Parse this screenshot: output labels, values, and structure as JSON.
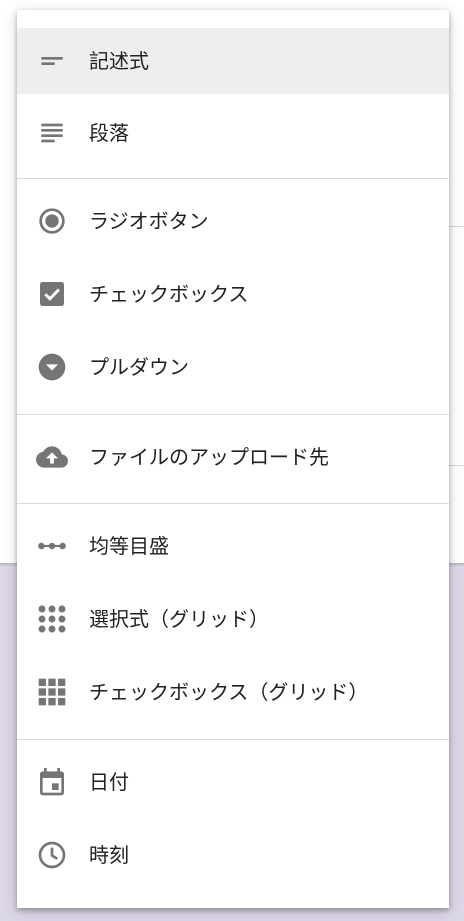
{
  "menu": {
    "items": [
      {
        "label": "記述式",
        "icon": "short-answer-icon",
        "selected": true
      },
      {
        "label": "段落",
        "icon": "paragraph-icon"
      },
      {
        "label": "ラジオボタン",
        "icon": "radio-button-icon"
      },
      {
        "label": "チェックボックス",
        "icon": "checkbox-icon"
      },
      {
        "label": "プルダウン",
        "icon": "dropdown-icon"
      },
      {
        "label": "ファイルのアップロード先",
        "icon": "cloud-upload-icon"
      },
      {
        "label": "均等目盛",
        "icon": "linear-scale-icon"
      },
      {
        "label": "選択式（グリッド）",
        "icon": "multiple-choice-grid-icon"
      },
      {
        "label": "チェックボックス（グリッド）",
        "icon": "checkbox-grid-icon"
      },
      {
        "label": "日付",
        "icon": "calendar-icon"
      },
      {
        "label": "時刻",
        "icon": "clock-icon"
      }
    ]
  },
  "colors": {
    "icon": "#757575",
    "text": "#202124",
    "selected_bg": "#eeeeee",
    "divider": "#dadce0",
    "page_lower_bg": "#ddd7ea"
  }
}
